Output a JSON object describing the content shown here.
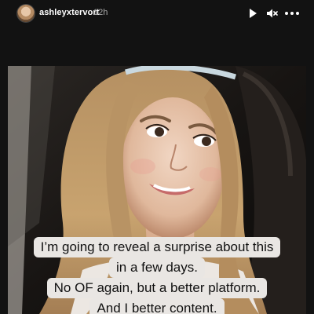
{
  "story": {
    "username": "ashleyxtervort",
    "timestamp": "12h",
    "controls": {
      "play_icon": "play-icon",
      "mute_icon": "muted-speaker-icon",
      "more_icon": "more-horizontal-icon"
    },
    "caption_lines": [
      "I’m going to reveal a surprise about this",
      "in a few days.",
      "No OF again, but a better platform.",
      "And I better content."
    ]
  },
  "colors": {
    "background": "#121212",
    "caption_bg": "#e9e6e3",
    "caption_text": "#111111",
    "username_text": "#ffffff",
    "timestamp_text": "#a8a8a8"
  }
}
